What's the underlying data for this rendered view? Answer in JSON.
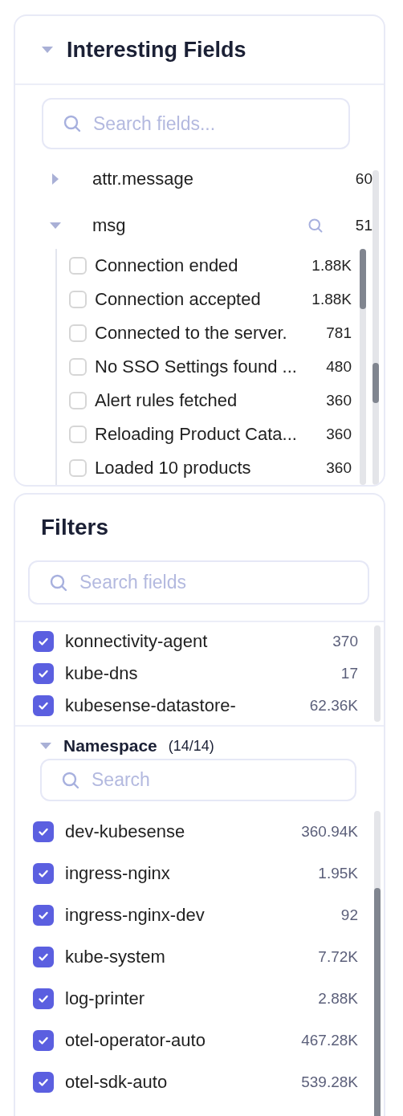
{
  "interesting_fields": {
    "title": "Interesting Fields",
    "expanded": true,
    "search": {
      "placeholder": "Search fields..."
    },
    "fields": [
      {
        "name": "attr.message",
        "count": "60",
        "expanded": false
      },
      {
        "name": "msg",
        "count": "51",
        "expanded": true,
        "values": [
          {
            "label": "Connection ended",
            "count": "1.88K",
            "checked": false
          },
          {
            "label": "Connection accepted",
            "count": "1.88K",
            "checked": false
          },
          {
            "label": "Connected to the server.",
            "count": "781",
            "checked": false
          },
          {
            "label": "No SSO Settings found ...",
            "count": "480",
            "checked": false
          },
          {
            "label": "Alert rules fetched",
            "count": "360",
            "checked": false
          },
          {
            "label": "Reloading Product Cata...",
            "count": "360",
            "checked": false
          },
          {
            "label": "Loaded 10 products",
            "count": "360",
            "checked": false
          }
        ]
      }
    ]
  },
  "filters": {
    "title": "Filters",
    "search": {
      "placeholder": "Search fields"
    },
    "items": [
      {
        "label": "konnectivity-agent",
        "count": "370",
        "checked": true
      },
      {
        "label": "kube-dns",
        "count": "17",
        "checked": true
      },
      {
        "label": "kubesense-datastore-",
        "count": "62.36K",
        "checked": true
      }
    ],
    "groups": [
      {
        "title": "Namespace",
        "count": "(14/14)",
        "expanded": true,
        "search": {
          "placeholder": "Search"
        },
        "items": [
          {
            "label": "dev-kubesense",
            "count": "360.94K",
            "checked": true
          },
          {
            "label": "ingress-nginx",
            "count": "1.95K",
            "checked": true
          },
          {
            "label": "ingress-nginx-dev",
            "count": "92",
            "checked": true
          },
          {
            "label": "kube-system",
            "count": "7.72K",
            "checked": true
          },
          {
            "label": "log-printer",
            "count": "2.88K",
            "checked": true
          },
          {
            "label": "otel-operator-auto",
            "count": "467.28K",
            "checked": true
          },
          {
            "label": "otel-sdk-auto",
            "count": "539.28K",
            "checked": true
          }
        ]
      }
    ]
  }
}
